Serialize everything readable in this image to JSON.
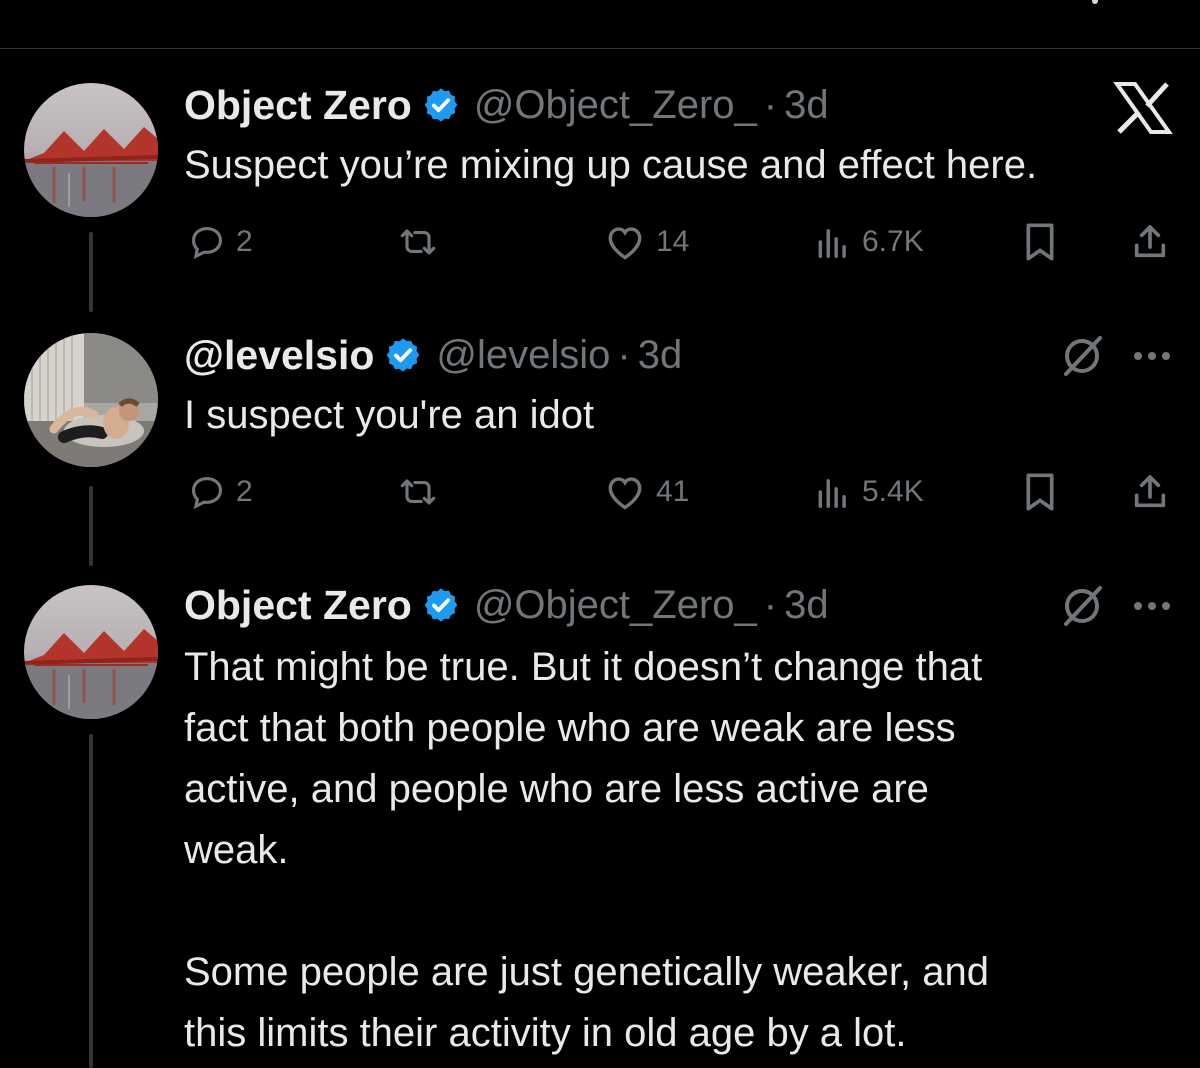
{
  "tweets": [
    {
      "display_name": "Object Zero",
      "handle": "@Object_Zero_",
      "separator": "·",
      "time": "3d",
      "text": "Suspect you’re mixing up cause and effect here.",
      "replies": "2",
      "likes": "14",
      "views": "6.7K",
      "avatar_icon": "bridge-photo",
      "corner_icon": "x-logo-icon"
    },
    {
      "display_name": "@levelsio",
      "handle": "@levelsio",
      "separator": "·",
      "time": "3d",
      "text": "I suspect you're an idot",
      "replies": "2",
      "likes": "41",
      "views": "5.4K",
      "avatar_icon": "person-on-couch-photo",
      "corner_icon": "grok-icon"
    },
    {
      "display_name": "Object Zero",
      "handle": "@Object_Zero_",
      "separator": "·",
      "time": "3d",
      "text": "That might be true. But it doesn’t change that\nfact that both people who are weak are less\nactive, and people who are less active are\nweak.\n\nSome people are just genetically weaker, and\nthis limits their activity in old age by a lot.",
      "avatar_icon": "bridge-photo",
      "corner_icon": "grok-icon"
    }
  ],
  "colors": {
    "background": "#000000",
    "text": "#e7e9ea",
    "muted": "#71767b",
    "verified": "#1d9bf0",
    "divider": "#2f3336"
  }
}
